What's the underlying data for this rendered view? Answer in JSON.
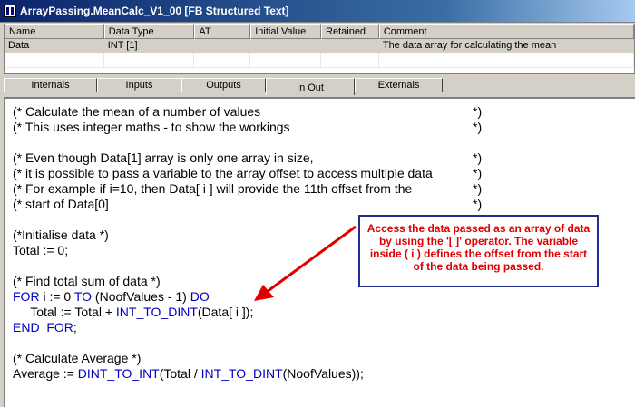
{
  "window": {
    "title": "ArrayPassing.MeanCalc_V1_00 [FB Structured Text]"
  },
  "variables_table": {
    "columns": [
      "Name",
      "Data Type",
      "AT",
      "Initial Value",
      "Retained",
      "Comment"
    ],
    "rows": [
      [
        "Data",
        "INT [1]",
        "",
        "",
        "",
        "The data array for calculating the mean"
      ]
    ]
  },
  "tabs": [
    {
      "label": "Internals",
      "active": false
    },
    {
      "label": "Inputs",
      "active": false
    },
    {
      "label": "Outputs",
      "active": false
    },
    {
      "label": "In Out",
      "active": true
    },
    {
      "label": "Externals",
      "active": false
    }
  ],
  "code": {
    "c1": "(* Calculate the mean of a number of values",
    "c1_end": "*)",
    "c2": "(* This uses integer maths - to show the workings",
    "c2_end": "*)",
    "c3": "(* Even though Data[1] array is only one array in size,",
    "c3_end": "*)",
    "c4": "(* it is possible to pass a variable to the array offset to access multiple data",
    "c4_end": "*)",
    "c5": "(* For example if i=10, then Data[ i ] will provide the 11th offset from the",
    "c5_end": "*)",
    "c6": "(* start of Data[0]",
    "c6_end": "*)",
    "c7": "(*Initialise data *)",
    "l_total_init": "Total := 0;",
    "c8": "(* Find total sum of data *)",
    "for_kw": "FOR",
    "for_mid1": " i := 0 ",
    "to_kw": "TO",
    "for_mid2": " (NoofValues - 1) ",
    "do_kw": "DO",
    "sum_pre": "     Total := Total + ",
    "int_to_dint_1": "INT_TO_DINT",
    "sum_post": "(Data[ i ]);",
    "end_for": "END_FOR",
    "end_for_semi": ";",
    "c9": "(* Calculate Average *)",
    "avg_pre": "Average := ",
    "dint_to_int": "DINT_TO_INT",
    "avg_mid": "(Total / ",
    "int_to_dint_2": "INT_TO_DINT",
    "avg_post": "(NoofValues));"
  },
  "callout": {
    "text": "Access the data passed as an array of data by using the '[ ]' operator.  The variable inside ( i ) defines the offset from the start of the data being passed."
  },
  "colors": {
    "keyword": "#0000c0",
    "callout_text": "#e00000",
    "callout_border": "#1f2f8c",
    "arrow": "#e00000"
  }
}
